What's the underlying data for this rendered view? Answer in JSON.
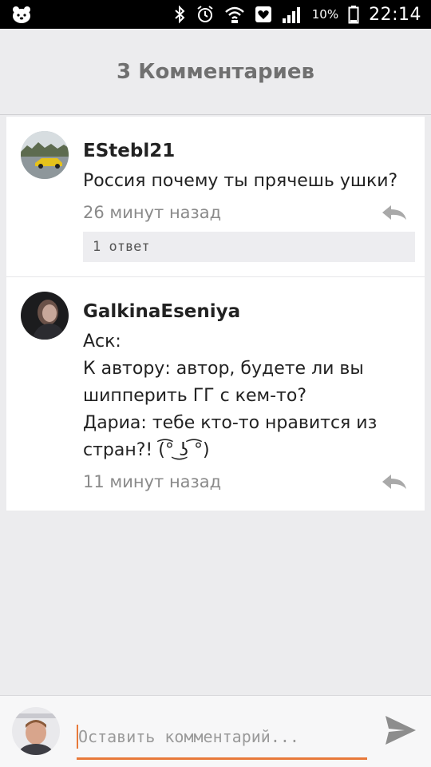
{
  "status_bar": {
    "battery": "10%",
    "time": "22:14",
    "icons": [
      "app-notification-icon",
      "bluetooth-icon",
      "alarm-icon",
      "wifi-icon",
      "heart-app-icon",
      "signal-icon",
      "battery-icon"
    ]
  },
  "header": {
    "title": "3 Комментариев"
  },
  "comments": [
    {
      "author": "EStebl21",
      "lines": [
        "Россия почему ты прячешь ушки?"
      ],
      "time": "26 минут назад",
      "replies_label": "1 ответ"
    },
    {
      "author": "GalkinaEseniya",
      "lines": [
        "Аск:",
        "К автору: автор, будете ли вы",
        "шипперить ГГ с кем-то?",
        "Дариа: тебе кто-то нравится из",
        "стран?! (͡° ͜ʖ ͡°)"
      ],
      "time": "11 минут назад"
    }
  ],
  "composer": {
    "placeholder": "Оставить комментарий..."
  },
  "colors": {
    "accent": "#e8793a",
    "header_text": "#707070",
    "meta_text": "#8a8a8a"
  }
}
